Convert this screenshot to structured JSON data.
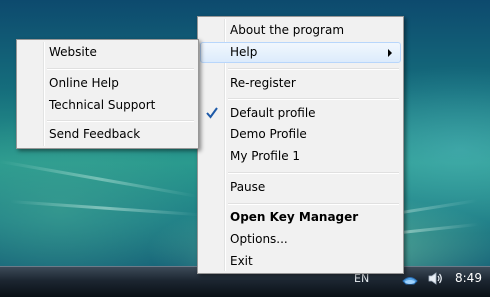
{
  "main_menu": {
    "items": {
      "about": "About the program",
      "help": "Help",
      "reregister": "Re-register",
      "default_profile": "Default profile",
      "demo_profile": "Demo Profile",
      "my_profile": "My Profile 1",
      "pause": "Pause",
      "key_manager": "Open Key Manager",
      "options": "Options...",
      "exit": "Exit"
    },
    "checked_item": "Default profile"
  },
  "help_submenu": {
    "items": {
      "website": "Website",
      "online_help": "Online Help",
      "tech_support": "Technical Support",
      "feedback": "Send Feedback"
    }
  },
  "taskbar": {
    "language": "EN",
    "time": "8:49"
  },
  "colors": {
    "menu_bg": "#f1f1f1",
    "highlight": "#dcebfc",
    "check": "#1e5aa8"
  },
  "icons": [
    "checkmark-icon",
    "submenu-arrow-icon",
    "network-icon",
    "volume-icon"
  ]
}
